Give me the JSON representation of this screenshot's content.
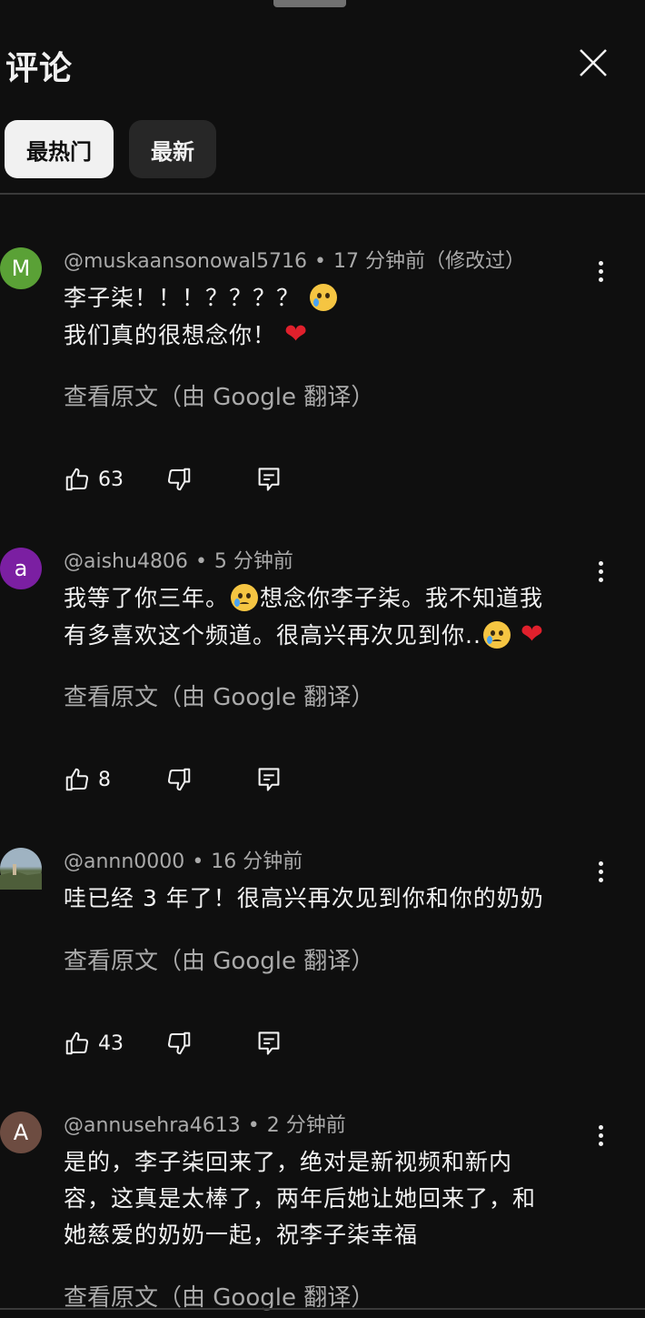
{
  "header": {
    "title": "评论",
    "close_icon": "close-icon"
  },
  "tabs": [
    {
      "label": "最热门",
      "active": true
    },
    {
      "label": "最新",
      "active": false
    }
  ],
  "translate_label": "查看原文（由 Google 翻译）",
  "comments": [
    {
      "avatar_letter": "M",
      "avatar_color": "#5aa136",
      "author": "@muskaansonowal5716",
      "time": "17 分钟前（修改过）",
      "line1": "李子柒！！！？？？？",
      "line2": "我们真的很想念你！",
      "likes": "63"
    },
    {
      "avatar_letter": "a",
      "avatar_color": "#7b1fa2",
      "author": "@aishu4806",
      "time": "5 分钟前",
      "line1a": "我等了你三年。",
      "line1b": "想念你李子柒。我不知道我",
      "line2": "有多喜欢这个频道。很高兴再次见到你..",
      "likes": "8"
    },
    {
      "avatar_letter": "",
      "avatar_color": "#6e8a9c",
      "author": "@annn0000",
      "time": "16 分钟前",
      "line1": "哇已经 3 年了！很高兴再次见到你和你的奶奶",
      "likes": "43"
    },
    {
      "avatar_letter": "A",
      "avatar_color": "#6d4c41",
      "author": "@annusehra4613",
      "time": "2 分钟前",
      "line1": "是的，李子柒回来了，绝对是新视频和新内",
      "line2": "容，这真是太棒了，两年后她让她回来了，和",
      "line3": "她慈爱的奶奶一起，祝李子柒幸福"
    }
  ],
  "icons": {
    "like": "thumbs-up-icon",
    "dislike": "thumbs-down-icon",
    "reply": "reply-icon",
    "more": "more-vert-icon"
  }
}
